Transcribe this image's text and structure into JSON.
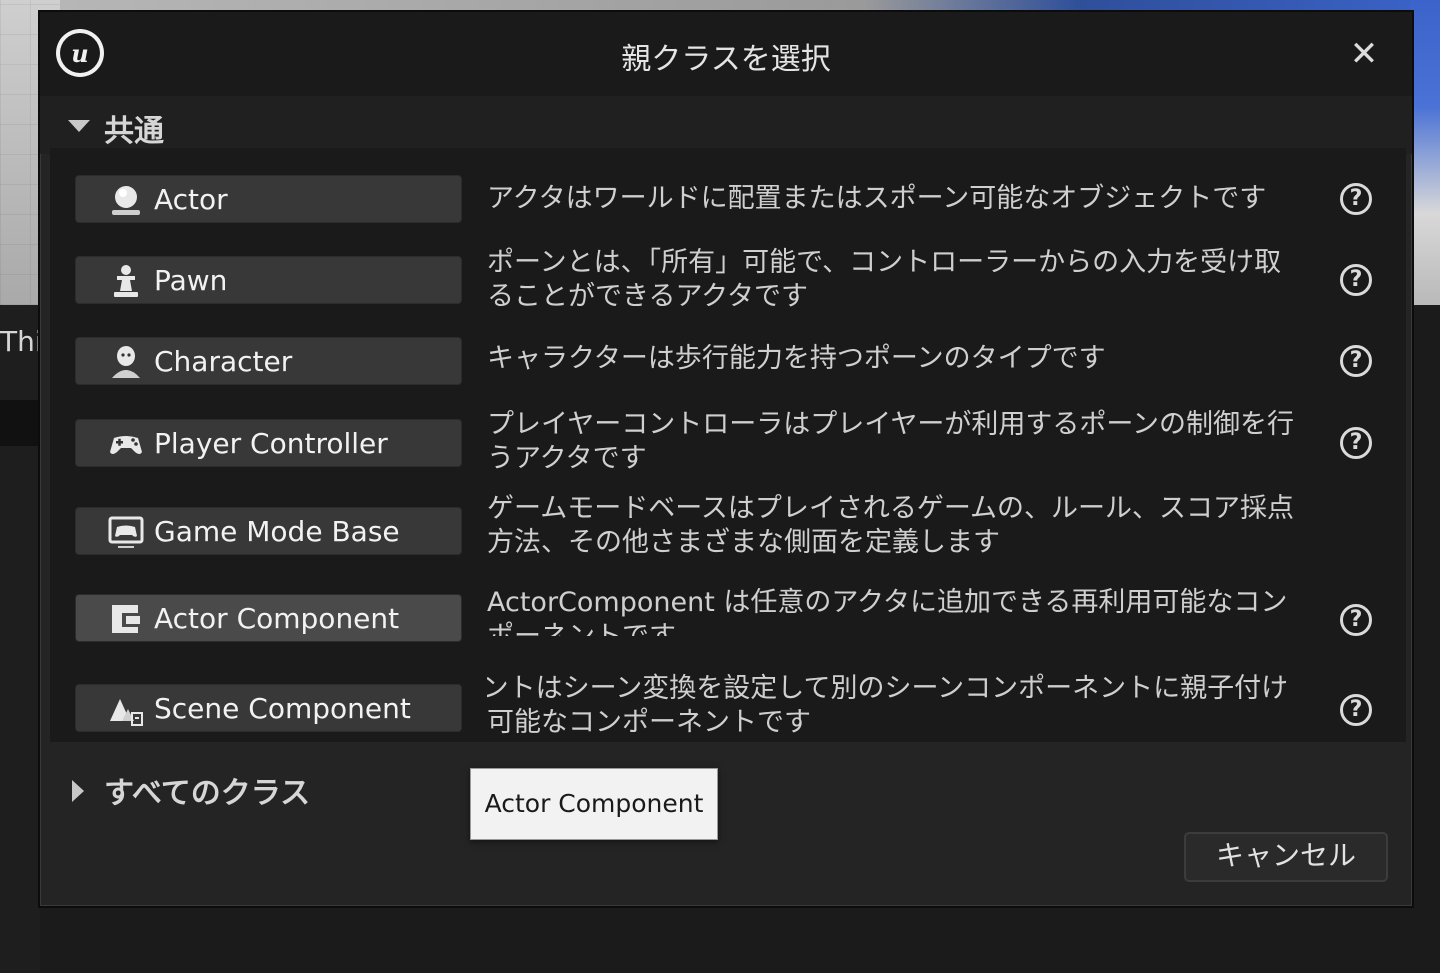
{
  "background": {
    "left_text": "Thi"
  },
  "dialog": {
    "title": "親クラスを選択",
    "logo_glyph": "u",
    "close_glyph": "✕"
  },
  "common_section": {
    "title": "共通",
    "expanded": true,
    "items": [
      {
        "label": "Actor",
        "icon": "actor-icon",
        "desc": "アクタはワールドに配置またはスポーン可能なオブジェクトです"
      },
      {
        "label": "Pawn",
        "icon": "pawn-icon",
        "desc": "ポーンとは、「所有」可能で、コントローラーからの入力を受け取ることができるアクタです"
      },
      {
        "label": "Character",
        "icon": "character-icon",
        "desc": "キャラクターは歩行能力を持つポーンのタイプです"
      },
      {
        "label": "Player Controller",
        "icon": "gamepad-icon",
        "desc": "プレイヤーコントローラはプレイヤーが利用するポーンの制御を行うアクタです"
      },
      {
        "label": "Game Mode Base",
        "icon": "game-mode-icon",
        "desc": "ゲームモードベースはプレイされるゲームの、ルール、スコア採点方法、その他さまざまな側面を定義します"
      },
      {
        "label": "Actor Component",
        "icon": "actor-component-icon",
        "desc": "ActorComponent は任意のアクタに追加できる再利用可能なコンポーネントです"
      },
      {
        "label": "Scene Component",
        "icon": "scene-component-icon",
        "desc": "シーンコンポーネントはシーン変換を設定して別のシーンコンポーネントに親子付け可能なコンポーネントです"
      }
    ]
  },
  "tooltip": {
    "text": "Actor Component"
  },
  "all_classes_section": {
    "title": "すべてのクラス",
    "expanded": false
  },
  "footer": {
    "cancel_label": "キャンセル"
  },
  "help_glyph": "?"
}
